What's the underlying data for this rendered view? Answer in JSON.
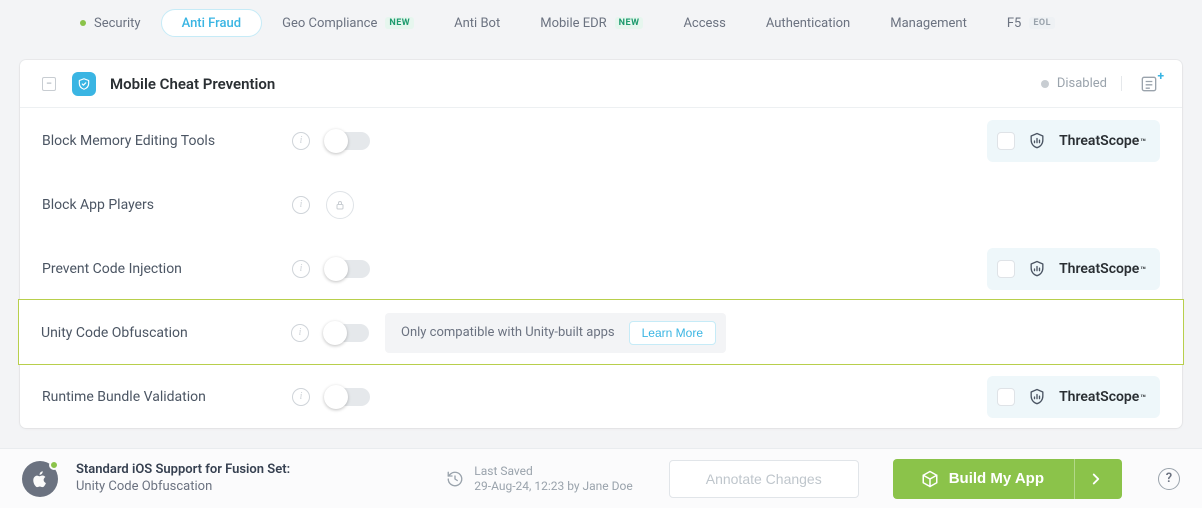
{
  "tabs": {
    "items": [
      {
        "label": "Security",
        "active": false,
        "dot": true
      },
      {
        "label": "Anti Fraud",
        "active": true
      },
      {
        "label": "Geo Compliance",
        "badge": "NEW",
        "badge_style": "new"
      },
      {
        "label": "Anti Bot"
      },
      {
        "label": "Mobile EDR",
        "badge": "NEW",
        "badge_style": "new"
      },
      {
        "label": "Access"
      },
      {
        "label": "Authentication"
      },
      {
        "label": "Management"
      },
      {
        "label": "F5",
        "badge": "EOL",
        "badge_style": "eol"
      }
    ]
  },
  "card": {
    "title": "Mobile Cheat Prevention",
    "status": "Disabled"
  },
  "threatscope": {
    "label": "ThreatScope",
    "tm": "™"
  },
  "rows": [
    {
      "label": "Block Memory Editing Tools",
      "toggle": "off",
      "ts": true
    },
    {
      "label": "Block App Players",
      "locked": true
    },
    {
      "label": "Prevent Code Injection",
      "toggle": "off",
      "ts": true
    },
    {
      "label": "Unity Code Obfuscation",
      "toggle": "off",
      "highlight": true,
      "notice": "Only compatible with Unity-built apps",
      "learn_more": "Learn More"
    },
    {
      "label": "Runtime Bundle Validation",
      "toggle": "off",
      "ts": true
    }
  ],
  "footer": {
    "title": "Standard iOS Support for Fusion Set:",
    "subtitle": "Unity Code Obfuscation",
    "last_saved_label": "Last Saved",
    "last_saved_value": "29-Aug-24, 12:23 by Jane Doe",
    "annotate": "Annotate Changes",
    "build": "Build My App",
    "help": "?"
  }
}
